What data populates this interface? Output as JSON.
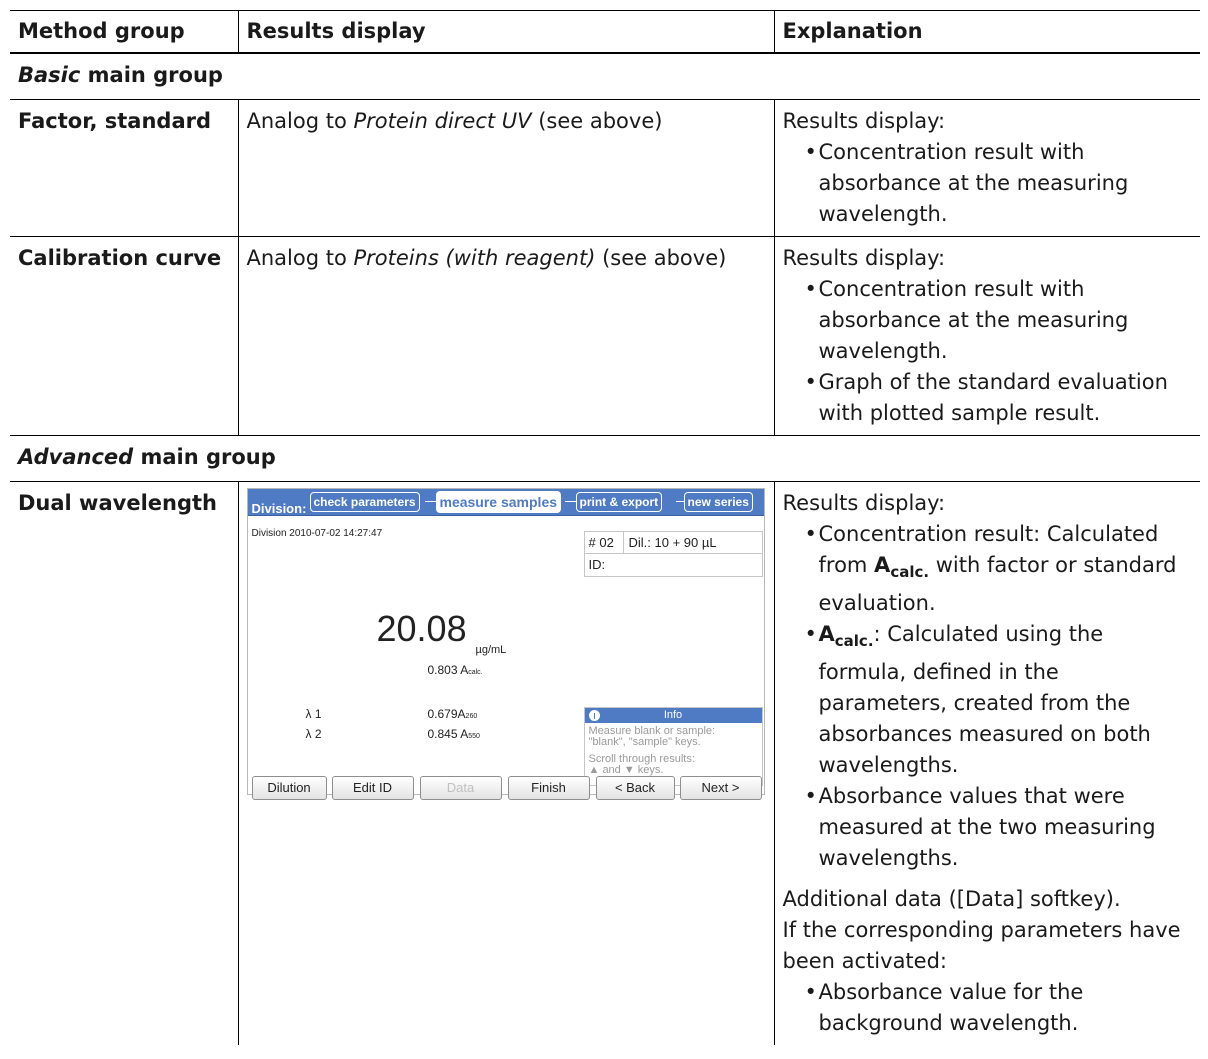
{
  "headers": [
    "Method group",
    "Results display",
    "Explanation"
  ],
  "group_basic": {
    "italic": "Basic",
    "rest": " main group"
  },
  "factor_row": {
    "method": "Factor, standard",
    "results_prefix": "Analog to ",
    "results_italic": "Protein direct UV",
    "results_suffix": " (see above)",
    "explanation_intro": "Results display:",
    "bullets": [
      "Concentration result with absorbance at the measuring wavelength."
    ]
  },
  "calib_row": {
    "method": "Calibration curve",
    "results_prefix": "Analog to ",
    "results_italic": "Proteins (with reagent)",
    "results_suffix": " (see above)",
    "explanation_intro": "Results display:",
    "bullets": [
      "Concentration result with absorbance at the measuring wavelength.",
      "Graph of the standard evaluation with plotted sample result."
    ]
  },
  "group_advanced": {
    "italic": "Advanced",
    "rest": " main group"
  },
  "dual_row": {
    "method": "Dual wavelength",
    "explanation_intro": "Results display:",
    "b1_part1": "Concentration result: Calculated from ",
    "b1_bold": "A",
    "b1_sub": "calc.",
    "b1_part2": " with factor or standard evaluation.",
    "b2_bold": "A",
    "b2_sub": "calc.",
    "b2_text": ": Calculated using the formula, defined in the parameters, created from the absorbances measured on both wavelengths.",
    "b3_text": "Absorbance values that were measured at the two measuring wavelengths.",
    "additional_1": "Additional data ([Data] softkey).",
    "additional_2": "If the corresponding parameters have been activated:",
    "b4_text": "Absorbance value for the background wavelength."
  },
  "screen": {
    "division_label": "Division:",
    "tabs": [
      "check parameters",
      "measure samples",
      "print & export",
      "new series"
    ],
    "header_line": "Division 2010-07-02 14:27:47",
    "sample_no": "# 02",
    "dilution": "Dil.: 10 + 90 µL",
    "id_label": "ID:",
    "concentration": "20.08",
    "conc_unit": "µg/mL",
    "abs_calc": "0.803 A",
    "abs_calc_sub": "calc.",
    "lambda1_label": "λ 1",
    "lambda1_value": "0.679A",
    "lambda1_sub": "260",
    "lambda2_label": "λ 2",
    "lambda2_value": "0.845 A",
    "lambda2_sub": "550",
    "info_title": "Info",
    "info_line1": "Measure blank or sample:",
    "info_line2": "\"blank\", \"sample\" keys.",
    "info_line3": "Scroll through results:",
    "info_line4": "▲ and ▼ keys.",
    "softkeys": [
      "Dilution",
      "Edit ID",
      "Data",
      "Finish",
      "< Back",
      "Next >"
    ]
  }
}
